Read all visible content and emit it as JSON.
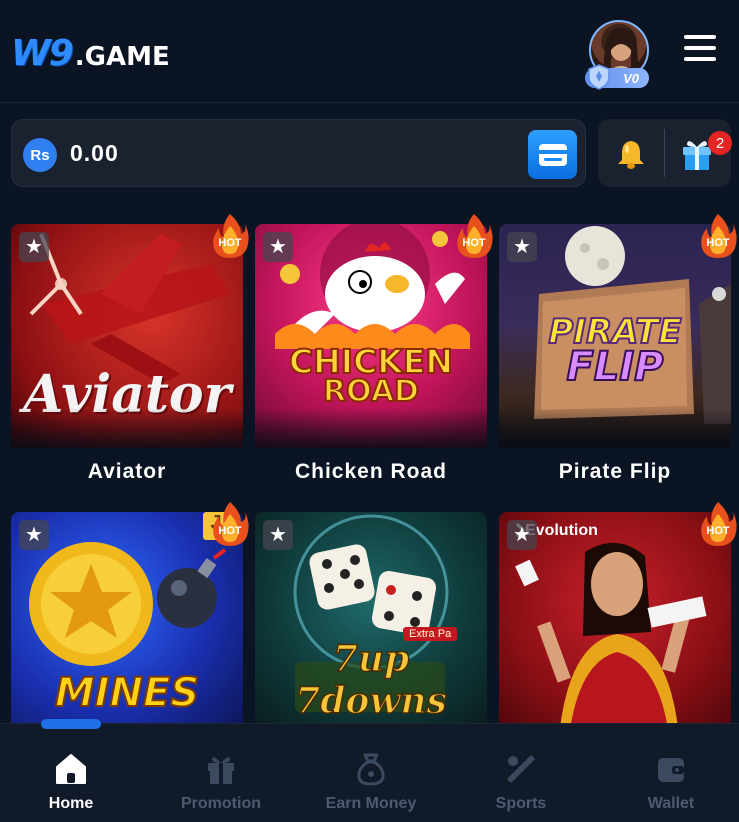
{
  "header": {
    "logo_mark": "W9",
    "logo_word": ".GAME",
    "vip_level": "V0"
  },
  "balance": {
    "currency_symbol": "Rs",
    "amount": "0.00"
  },
  "notifications": {
    "gift_count": "2"
  },
  "games": [
    {
      "name": "Aviator",
      "thumb_text": "Aviator",
      "badge": "HOT"
    },
    {
      "name": "Chicken Road",
      "thumb_text_1": "CHICKEN",
      "thumb_text_2": "ROAD",
      "badge": "HOT"
    },
    {
      "name": "Pirate Flip",
      "thumb_text_1": "PIRATE",
      "thumb_text_2": "FLIP",
      "badge": "HOT"
    },
    {
      "thumb_text": "MINES",
      "badge": "HOT",
      "corner": "J"
    },
    {
      "thumb_text": "7up 7downs",
      "subtext": "Extra Pa"
    },
    {
      "provider": "Evolution",
      "badge": "HOT"
    }
  ],
  "nav": {
    "items": [
      {
        "label": "Home",
        "icon": "home-icon",
        "active": true
      },
      {
        "label": "Promotion",
        "icon": "gift-icon",
        "active": false
      },
      {
        "label": "Earn Money",
        "icon": "money-bag-icon",
        "active": false
      },
      {
        "label": "Sports",
        "icon": "sports-icon",
        "active": false
      },
      {
        "label": "Wallet",
        "icon": "wallet-icon",
        "active": false
      }
    ]
  },
  "colors": {
    "background": "#0b1422",
    "accent": "#1f6fe6",
    "hot": "#e8501c"
  }
}
